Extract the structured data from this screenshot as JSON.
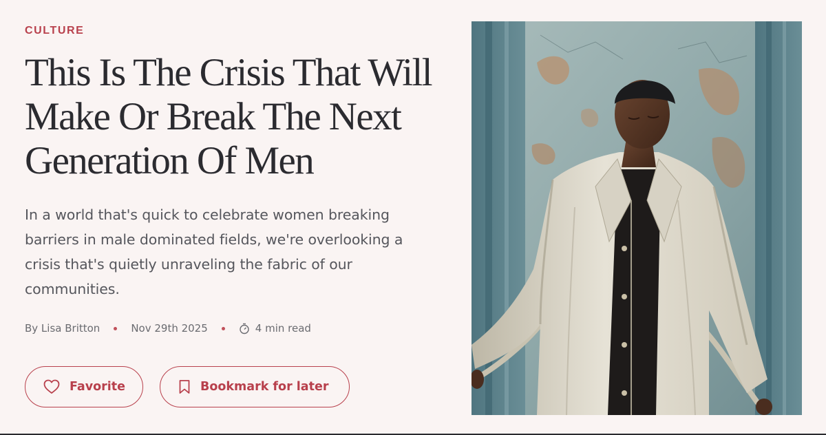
{
  "article": {
    "category": "CULTURE",
    "headline": "This Is The Crisis That Will Make Or Break The Next Generation Of Men",
    "dek": "In a world that's quick to celebrate women breaking barriers in male dominated fields, we're overlooking a crisis that's quietly unraveling the fabric of our communities.",
    "byline": "By Lisa Britton",
    "date": "Nov 29th 2025",
    "read_time": "4 min read"
  },
  "actions": {
    "favorite_label": "Favorite",
    "bookmark_label": "Bookmark for later"
  },
  "icons": {
    "favorite": "heart-icon",
    "bookmark": "bookmark-icon",
    "read_time": "timer-icon"
  },
  "colors": {
    "accent": "#b8404c",
    "background": "#faf4f3",
    "headline": "#2b2b30",
    "body": "#55565c"
  }
}
